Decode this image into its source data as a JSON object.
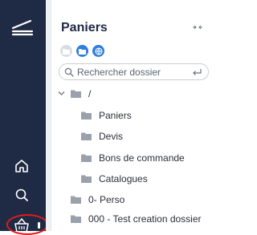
{
  "sidebar": {
    "logo": "app-logo",
    "nav": [
      {
        "name": "home-icon",
        "label": "Accueil"
      },
      {
        "name": "search-icon",
        "label": "Rechercher"
      },
      {
        "name": "basket-icon",
        "label": "Paniers"
      }
    ],
    "highlight_color": "#e01b1b",
    "background": "#1f2a44"
  },
  "panel": {
    "title": "Paniers",
    "collapse_icon": "collapse-arrows-icon",
    "view_buttons": [
      "folder-grey-icon",
      "folder-blue-icon",
      "globe-blue-icon"
    ],
    "search": {
      "placeholder": "Rechercher dossier",
      "value": ""
    },
    "tree": {
      "root": "/",
      "children": [
        "Paniers",
        "Devis",
        "Bons de commande",
        "Catalogues"
      ],
      "siblings": [
        "0- Perso",
        "000 - Test creation dossier"
      ]
    }
  }
}
